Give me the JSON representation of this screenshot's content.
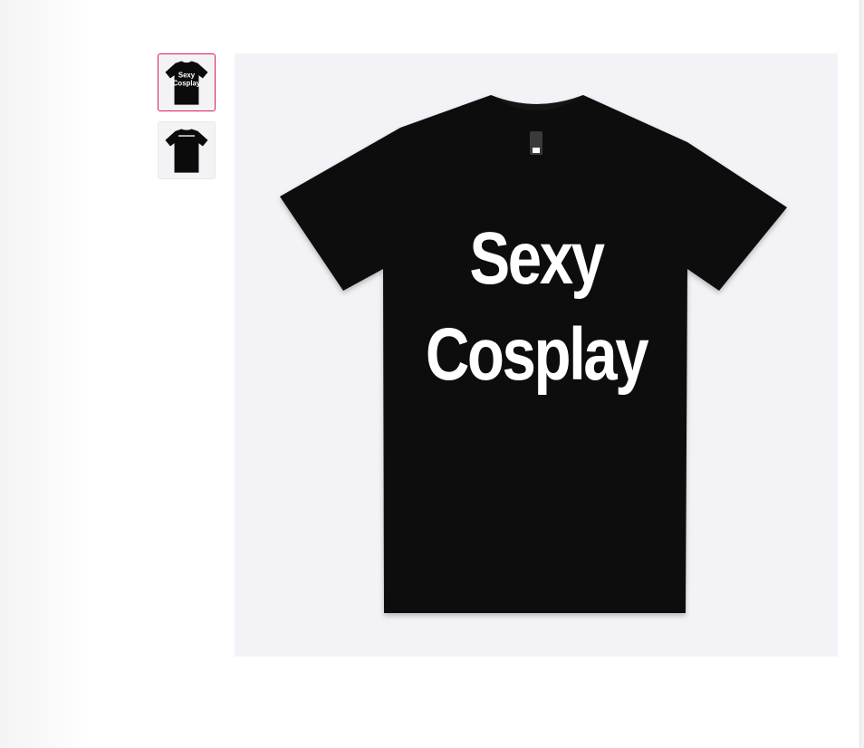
{
  "product": {
    "print_line1": "Sexy",
    "print_line2": "Cosplay"
  },
  "gallery": {
    "selected_index": 0,
    "thumbnails": [
      {
        "view": "front",
        "selected": true
      },
      {
        "view": "back",
        "selected": false
      }
    ]
  },
  "colors": {
    "shirt": "#0b0b0b",
    "background": "#f3f3f7",
    "selected_border": "#d81b60"
  }
}
